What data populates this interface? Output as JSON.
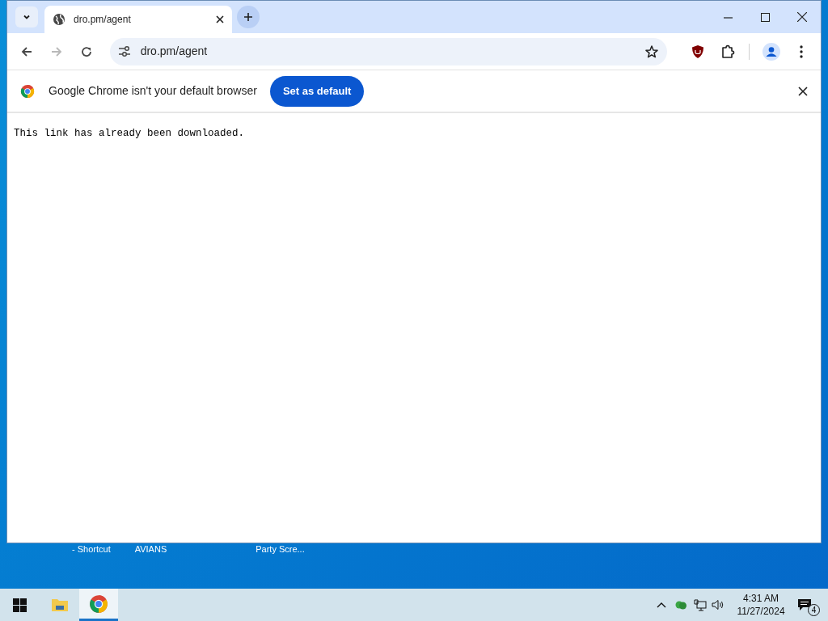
{
  "tabs": [
    {
      "title": "dro.pm/agent",
      "selected": true
    }
  ],
  "address": "dro.pm/agent",
  "infobar": {
    "message": "Google Chrome isn't your default browser",
    "button": "Set as default"
  },
  "content": "This link has already been downloaded.",
  "desktop_icons": [
    {
      "label": "- Shortcut"
    },
    {
      "label": "AVIANS"
    },
    {
      "label": "Party Scre..."
    }
  ],
  "taskbar": {
    "apps": [
      {
        "kind": "explorer",
        "selected": false
      },
      {
        "kind": "chrome",
        "selected": true
      }
    ],
    "time": "4:31 AM",
    "date": "11/27/2024",
    "notifications": "4"
  }
}
